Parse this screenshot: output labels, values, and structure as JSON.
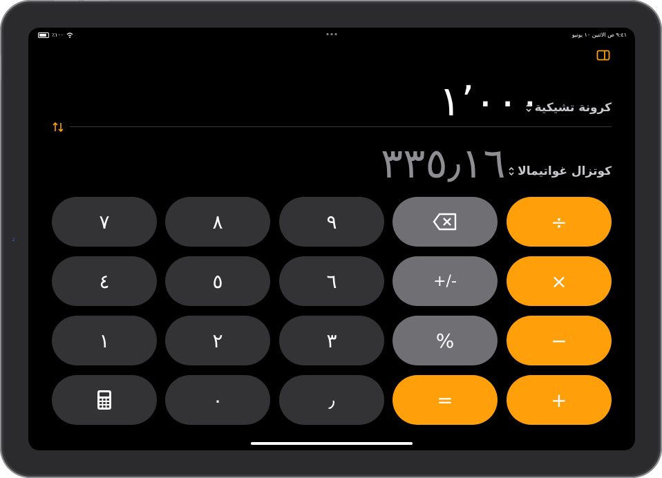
{
  "status_bar": {
    "battery_text": "٪١٠٠",
    "time_date": "٩:٤١ ص   الاثنين ١٠ يونيو"
  },
  "converter": {
    "from_currency": "كرونة تشيكية",
    "from_amount": "١٬٠٠٠",
    "to_currency": "كوتزال غواتيمالا",
    "to_amount": "٣٣٥٫١٦"
  },
  "keypad": {
    "row1": [
      "٧",
      "٨",
      "٩",
      "delete",
      "÷"
    ],
    "row2": [
      "٤",
      "٥",
      "٦",
      "+/-",
      "×"
    ],
    "row3": [
      "١",
      "٢",
      "٣",
      "%",
      "−"
    ],
    "row4": [
      "calculator",
      "٠",
      "٫",
      "=",
      "+"
    ]
  },
  "colors": {
    "accent": "#ff9f0a",
    "digit_key": "#333335",
    "function_key": "#707074",
    "background": "#000000"
  },
  "icons": {
    "sidebar": "sidebar-icon",
    "swap": "swap-arrows-icon",
    "delete": "backspace-icon",
    "calculator": "calculator-icon",
    "chevron": "chevron-up-down-icon"
  }
}
